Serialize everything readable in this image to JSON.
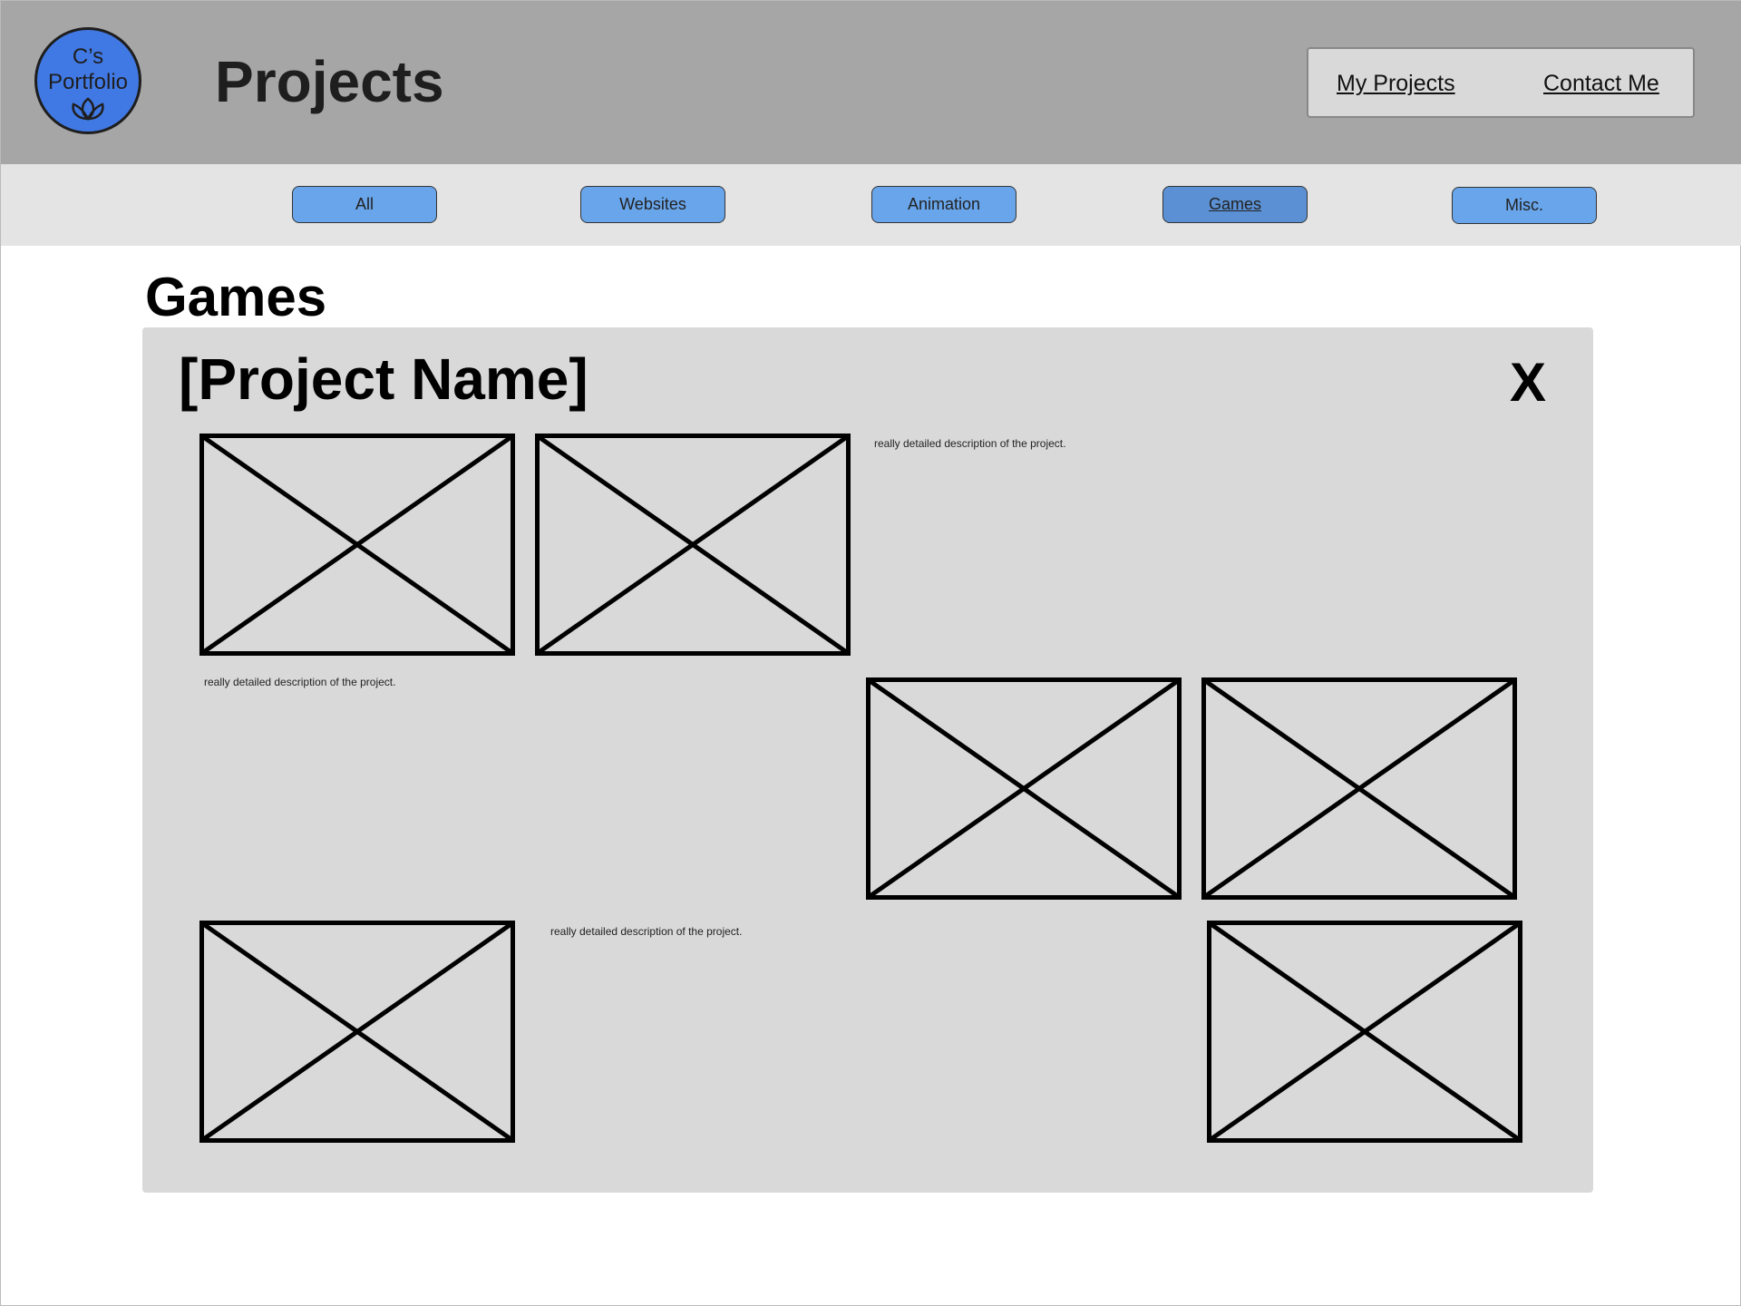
{
  "header": {
    "logo": {
      "line1": "C’s",
      "line2": "Portfolio",
      "icon": "lotus-icon"
    },
    "title": "Projects",
    "nav": [
      {
        "label": "My Projects"
      },
      {
        "label": "Contact Me"
      }
    ]
  },
  "filters": [
    {
      "label": "All",
      "active": false
    },
    {
      "label": "Websites",
      "active": false
    },
    {
      "label": "Animation",
      "active": false
    },
    {
      "label": "Games",
      "active": true
    },
    {
      "label": "Misc.",
      "active": false
    }
  ],
  "section_title": "Games",
  "project": {
    "name": "[Project Name]",
    "close_label": "X",
    "descriptions": [
      "really detailed description of the project.",
      "really detailed description of the project.",
      "really detailed description of the project."
    ],
    "image_placeholder_count": 6
  },
  "colors": {
    "header_bg": "#a6a6a6",
    "filter_bg": "#e4e4e4",
    "button": "#69a5ea",
    "button_active": "#5b91d4",
    "logo": "#4179e4",
    "panel": "#d9d9d9"
  }
}
